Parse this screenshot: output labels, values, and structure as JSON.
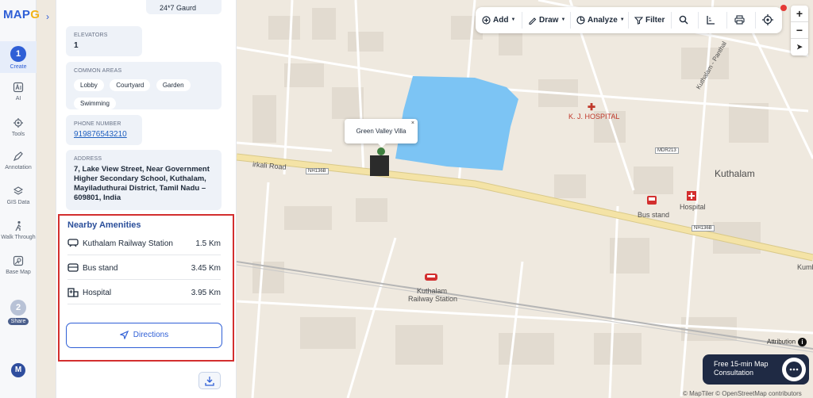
{
  "app": {
    "logo_prefix": "MAP",
    "logo_accent": "G",
    "logo_suffix": "",
    "avatar_initial": "M"
  },
  "rail": {
    "items": [
      {
        "label": "Create",
        "step": "1"
      },
      {
        "label": "AI"
      },
      {
        "label": "Tools"
      },
      {
        "label": "Annotation"
      },
      {
        "label": "GIS Data"
      },
      {
        "label": "Walk Through"
      },
      {
        "label": "Base Map"
      },
      {
        "label": "Share",
        "step": "2"
      }
    ]
  },
  "panel": {
    "security_value": "24*7 Gaurd",
    "elevators": {
      "label": "ELEVATORS",
      "value": "1"
    },
    "common_areas": {
      "label": "COMMON AREAS",
      "chips": [
        "Lobby",
        "Courtyard",
        "Garden",
        "Swimming"
      ]
    },
    "phone": {
      "label": "PHONE NUMBER",
      "value": "919876543210"
    },
    "address": {
      "label": "ADDRESS",
      "value": "7, Lake View Street, Near Government Higher Secondary School, Kuthalam, Mayiladuthurai District, Tamil Nadu – 609801, India"
    },
    "amenities": {
      "title": "Nearby Amenities",
      "rows": [
        {
          "name": "Kuthalam Railway Station",
          "distance": "1.5 Km",
          "icon": "train-icon"
        },
        {
          "name": "Bus stand",
          "distance": "3.45 Km",
          "icon": "bus-icon"
        },
        {
          "name": "Hospital",
          "distance": "3.95 Km",
          "icon": "hospital-icon"
        }
      ],
      "directions_label": "Directions"
    }
  },
  "toolbar": {
    "add": "Add",
    "draw": "Draw",
    "analyze": "Analyze",
    "filter": "Filter"
  },
  "map": {
    "popup_title": "Green Valley Villa",
    "popup_close": "×",
    "labels": {
      "hospital_kj": "K. J. HOSPITAL",
      "road_sirkali": "irkali Road",
      "kuthalam": "Kuthalam",
      "bus_stand": "Bus stand",
      "hospital": "Hospital",
      "railway_station_l1": "Kuthalam",
      "railway_station_l2": "Railway Station",
      "kumb": "Kumb",
      "panthal": "Kuthalam - Panthal",
      "shield_nh1": "NH136B",
      "shield_nh2": "NH136B",
      "shield_mdr": "MDR213"
    },
    "attribution": "Attribution",
    "consult_line1": "Free 15-min Map",
    "consult_line2": "Consultation",
    "copyright": "© MapTiler © OpenStreetMap contributors"
  },
  "colors": {
    "accent": "#2f5fd6",
    "highlight_border": "#d32f2f",
    "lake": "#7cc4f4",
    "road_major": "#f4e3a6"
  }
}
